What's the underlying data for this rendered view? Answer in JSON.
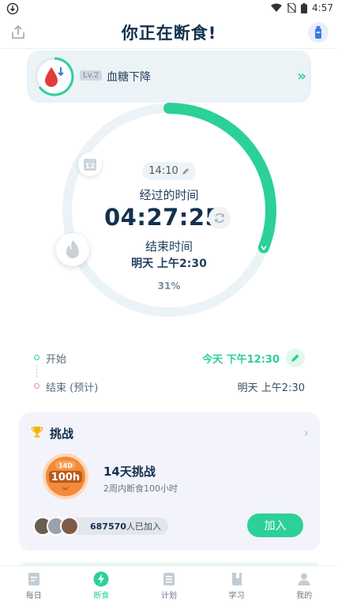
{
  "status_bar": {
    "time": "4:57"
  },
  "header": {
    "title": "你正在断食!"
  },
  "stage": {
    "level": "Lv.2",
    "label": "血糖下降",
    "arrow": "»"
  },
  "timer": {
    "start_clock": "14:10",
    "elapsed_label": "经过的时间",
    "elapsed": "04:27:25",
    "end_label": "结束时间",
    "end_time": "明天 上午2:30",
    "percent": "31%",
    "progress_fraction": 0.31,
    "clock_badge": "12"
  },
  "schedule": {
    "start_label": "开始",
    "start_value": "今天 下午12:30",
    "end_label": "结束 (预计)",
    "end_value": "明天 上午2:30"
  },
  "challenge": {
    "section_title": "挑战",
    "medal_top": "14D",
    "medal_main": "100h",
    "name": "14天挑战",
    "description": "2周内断食100小时",
    "participants_count": "687570",
    "participants_suffix": "人已加入",
    "join_label": "加入"
  },
  "tabs": [
    {
      "label": "每日",
      "icon": "daily-icon",
      "active": false
    },
    {
      "label": "断食",
      "icon": "fasting-bolt-icon",
      "active": true
    },
    {
      "label": "计划",
      "icon": "plan-icon",
      "active": false
    },
    {
      "label": "学习",
      "icon": "learn-book-icon",
      "active": false
    },
    {
      "label": "我的",
      "icon": "profile-icon",
      "active": false
    }
  ],
  "colors": {
    "accent": "#2bd197",
    "ring_track": "#ecf3f7",
    "title": "#13314f",
    "end_dot": "#f28b8b",
    "medal": "#f28a3a"
  }
}
